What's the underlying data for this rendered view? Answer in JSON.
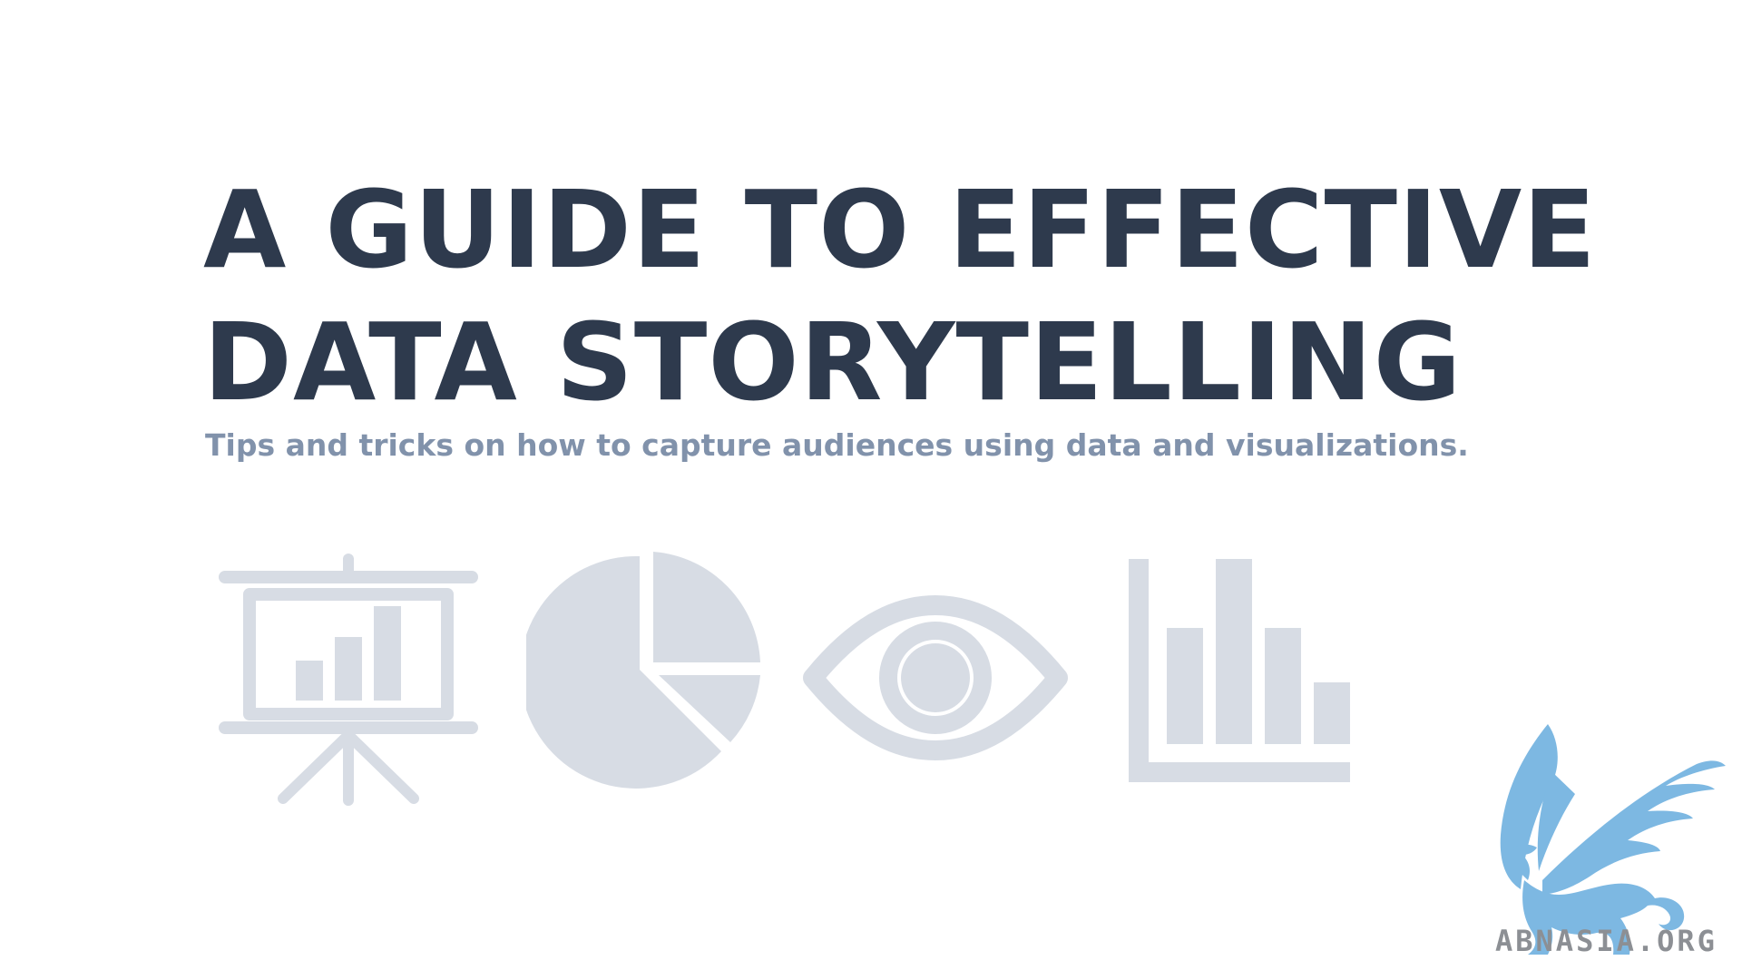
{
  "title": {
    "line1": "A GUIDE TO EFFECTIVE",
    "line2": "DATA STORYTELLING"
  },
  "subtitle": "Tips and tricks on how to capture audiences using data and visualizations.",
  "icons": [
    "presentation-board-icon",
    "pie-chart-icon",
    "eye-icon",
    "bar-chart-icon"
  ],
  "logo": {
    "text": "ABNASIA.ORG"
  },
  "colors": {
    "title": "#2e3a4d",
    "subtitle": "#8192ab",
    "icon": "#d7dce4",
    "logo": "#7db8e2",
    "logo_text": "#8c8f94"
  }
}
